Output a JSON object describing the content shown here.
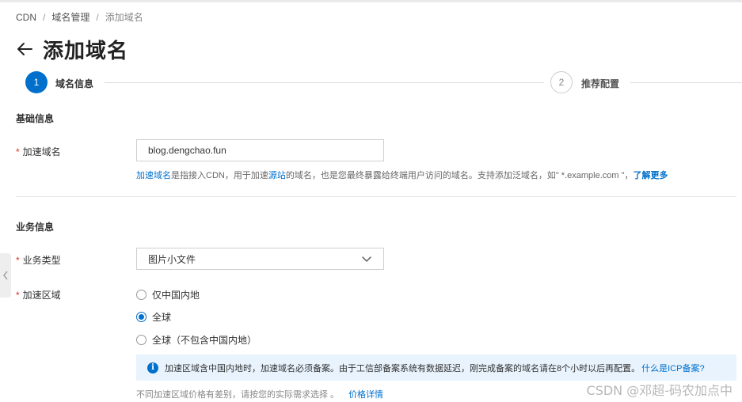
{
  "breadcrumb": {
    "items": [
      "CDN",
      "域名管理",
      "添加域名"
    ],
    "separator": "/"
  },
  "page": {
    "title": "添加域名"
  },
  "steps": [
    {
      "number": "1",
      "label": "域名信息",
      "active": true
    },
    {
      "number": "2",
      "label": "推荐配置",
      "active": false
    }
  ],
  "basic": {
    "section_title": "基础信息",
    "domain_label": "加速域名",
    "required_mark": "*",
    "domain_value": "blog.dengchao.fun",
    "help": {
      "link1": "加速域名",
      "text1": "是指接入CDN，用于加速",
      "link2": "源站",
      "text2": "的域名，也是您最终暴露给终端用户访问的域名。支持添加泛域名，如\" *.example.com \"，",
      "learn_more": "了解更多"
    }
  },
  "business": {
    "section_title": "业务信息",
    "type_label": "业务类型",
    "type_value": "图片小文件",
    "region_label": "加速区域",
    "region_options": [
      {
        "label": "仅中国内地",
        "checked": false
      },
      {
        "label": "全球",
        "checked": true
      },
      {
        "label": "全球（不包含中国内地）",
        "checked": false
      }
    ],
    "info_icon": "info-icon",
    "info_text": "加速区域含中国内地时，加速域名必须备案。由于工信部备案系统有数据延迟，刚完成备案的域名请在8个小时以后再配置。",
    "info_link": "什么是ICP备案?",
    "price_note": "不同加速区域价格有差别，请按您的实际需求选择 。",
    "price_link": "价格详情"
  },
  "watermark": "CSDN @邓超-码农加点中",
  "colors": {
    "accent": "#0070cc",
    "required": "#d93026",
    "info_bg": "#e8f3fd"
  }
}
